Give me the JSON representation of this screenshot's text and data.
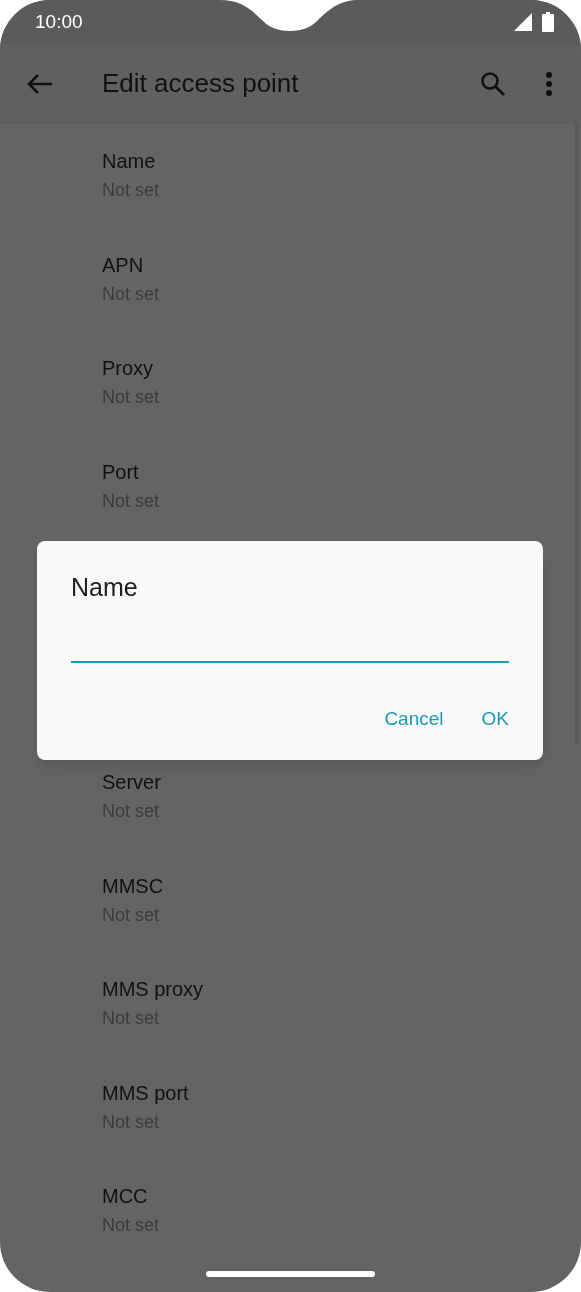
{
  "status_bar": {
    "time": "10:00"
  },
  "toolbar": {
    "title": "Edit access point"
  },
  "settings_above": [
    {
      "title": "Name",
      "summary": "Not set"
    },
    {
      "title": "APN",
      "summary": "Not set"
    },
    {
      "title": "Proxy",
      "summary": "Not set"
    },
    {
      "title": "Port",
      "summary": "Not set"
    }
  ],
  "settings_below": [
    {
      "title": "Server",
      "summary": "Not set"
    },
    {
      "title": "MMSC",
      "summary": "Not set"
    },
    {
      "title": "MMS proxy",
      "summary": "Not set"
    },
    {
      "title": "MMS port",
      "summary": "Not set"
    },
    {
      "title": "MCC",
      "summary": "Not set"
    }
  ],
  "dialog": {
    "title": "Name",
    "buttons": [
      "Cancel",
      "OK"
    ]
  }
}
